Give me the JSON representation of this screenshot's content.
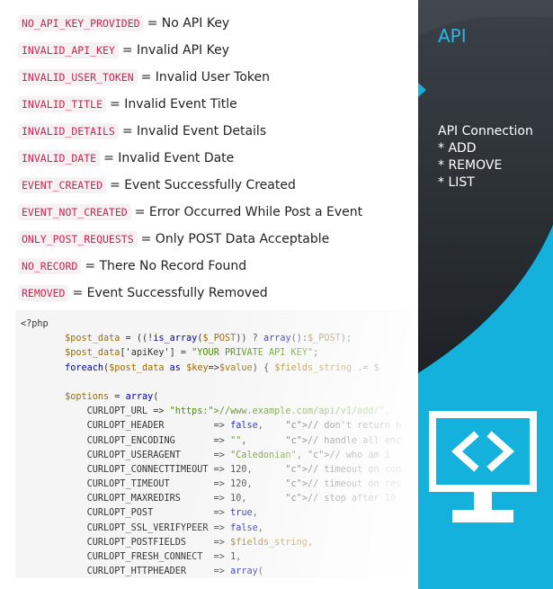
{
  "errors": [
    {
      "code": "NO_API_KEY_PROVIDED",
      "desc": "= No API Key"
    },
    {
      "code": "INVALID_API_KEY",
      "desc": "= Invalid API Key"
    },
    {
      "code": "INVALID_USER_TOKEN",
      "desc": "= Invalid User Token"
    },
    {
      "code": "INVALID_TITLE",
      "desc": "= Invalid Event Title"
    },
    {
      "code": "INVALID_DETAILS",
      "desc": "= Invalid Event Details"
    },
    {
      "code": "INVALID_DATE",
      "desc": "= Invalid Event Date"
    },
    {
      "code": "EVENT_CREATED",
      "desc": "= Event Successfully Created"
    },
    {
      "code": "EVENT_NOT_CREATED",
      "desc": "= Error Occurred While Post a Event"
    },
    {
      "code": "ONLY_POST_REQUESTS",
      "desc": "= Only POST Data Acceptable"
    },
    {
      "code": "NO_RECORD",
      "desc": "= There No Record Found"
    },
    {
      "code": "REMOVED",
      "desc": "= Event Successfully Removed"
    }
  ],
  "code_lines": [
    "<?php",
    "        $post_data = ((!is_array($_POST)) ? array():$_POST);",
    "        $post_data['apiKey'] = \"YOUR PRIVATE API KEY\";",
    "        foreach($post_data as $key=>$value) { $fields_string .= $",
    "",
    "        $options = array(",
    "            CURLOPT_URL => \"https://www.example.com/api/v1/add/\",",
    "            CURLOPT_HEADER         => false,    // don't return h",
    "            CURLOPT_ENCODING       => \"\",       // handle all enc",
    "            CURLOPT_USERAGENT      => \"Caledonian\", // who am i",
    "            CURLOPT_CONNECTTIMEOUT => 120,      // timeout on con",
    "            CURLOPT_TIMEOUT        => 120,      // timeout on res",
    "            CURLOPT_MAXREDIRS      => 10,       // stop after 10",
    "            CURLOPT_POST           => true,",
    "            CURLOPT_SSL_VERIFYPEER => false,",
    "            CURLOPT_POSTFIELDS     => $fields_string,",
    "            CURLOPT_FRESH_CONNECT  => 1,",
    "            CURLOPT_HTTPHEADER     => array("
  ],
  "sidebar": {
    "title": "API",
    "section_title": "API Connection",
    "items": [
      "* ADD",
      "* REMOVE",
      "* LIST"
    ],
    "icon": "code-monitor-icon"
  },
  "colors": {
    "accent": "#14b1dd",
    "dark_panel": "#2a2f34",
    "code_tag": "#c7254e"
  }
}
